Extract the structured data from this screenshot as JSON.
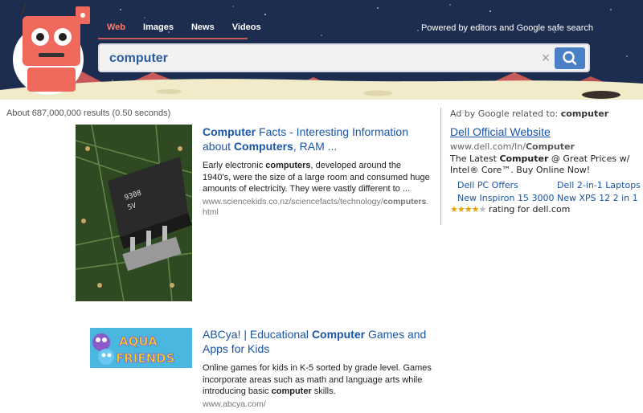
{
  "header": {
    "tabs": [
      {
        "label": "Web",
        "active": true
      },
      {
        "label": "Images",
        "active": false
      },
      {
        "label": "News",
        "active": false
      },
      {
        "label": "Videos",
        "active": false
      }
    ],
    "powered_by": "Powered by editors and Google safe search",
    "search_value": "computer",
    "clear_icon": "close-icon",
    "search_icon": "search-icon"
  },
  "stats": "About 687,000,000 results (0.50 seconds)",
  "results": [
    {
      "title_html_parts": [
        "Computer",
        " Facts - Interesting Information about ",
        "Computers",
        ", RAM ..."
      ],
      "snippet_parts": [
        "Early electronic ",
        "computers",
        ", developed around the 1940's, were the size of a large room and consumed huge amounts of electricity. They were vastly different to ..."
      ],
      "url_parts": [
        "www.sciencekids.co.nz/sciencefacts/technology/",
        "computers",
        ".html"
      ]
    },
    {
      "title_parts": [
        "ABCya! | Educational ",
        "Computer",
        " Games and Apps for Kids"
      ],
      "snippet_parts": [
        "Online games for kids in K-5 sorted by grade level. Games incorporate areas such as math and language arts while introducing basic ",
        "computer",
        " skills."
      ],
      "url": "www.abcya.com/",
      "thumb_text": "AQUA FRIENDS"
    }
  ],
  "ad": {
    "label": "Ad by Google related to: ",
    "label_term": "computer",
    "title": "Dell Official Website",
    "url_prefix": "www.dell.com/In/",
    "url_bold": "Computer",
    "desc_parts": [
      "The Latest ",
      "Computer",
      " @ Great Prices w/ Intel® Core™. Buy Online Now!"
    ],
    "sitelinks": [
      "Dell PC Offers",
      "Dell 2-in-1 Laptops",
      "New Inspiron 15 3000",
      "New XPS 12 2 in 1"
    ],
    "rating_stars": 4,
    "rating_text": "rating for dell.com"
  },
  "colors": {
    "header_bg": "#1c2d4f",
    "accent_tab": "#ff7a6a",
    "link": "#1a55a8",
    "search_button": "#4a80c6",
    "robot": "#ef6a5d"
  }
}
